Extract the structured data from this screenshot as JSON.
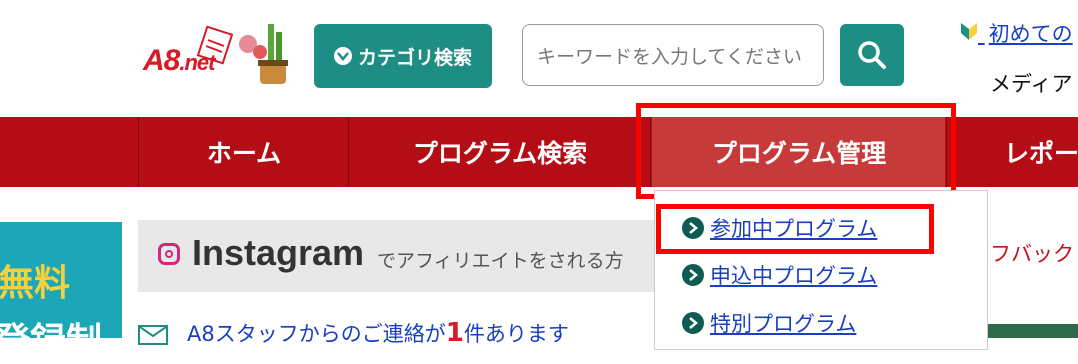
{
  "header": {
    "logo_text": "A8",
    "logo_net": ".net",
    "category_button": "カテゴリ検索",
    "search_placeholder": "キーワードを入力してください",
    "first_time_link": "初めての",
    "media_label": "メディア"
  },
  "nav": {
    "items": [
      {
        "label": "ホーム"
      },
      {
        "label": "プログラム検索"
      },
      {
        "label": "プログラム管理"
      },
      {
        "label": "レポー"
      }
    ]
  },
  "dropdown": {
    "items": [
      {
        "label": "参加中プログラム"
      },
      {
        "label": "申込中プログラム"
      },
      {
        "label": "特別プログラム"
      }
    ]
  },
  "left_banner": {
    "line1": "無料",
    "line2": "登録制"
  },
  "instagram": {
    "title": "Instagram",
    "subtitle": "でアフィリエイトをされる方"
  },
  "message": {
    "prefix": "A8スタッフからのご連絡が",
    "count": "1",
    "suffix": "件あります"
  },
  "right_fragment": "フバック",
  "colors": {
    "nav_red": "#b50d15",
    "teal": "#1e8e84",
    "highlight": "#ff0000",
    "link_blue": "#1a3fbf"
  }
}
